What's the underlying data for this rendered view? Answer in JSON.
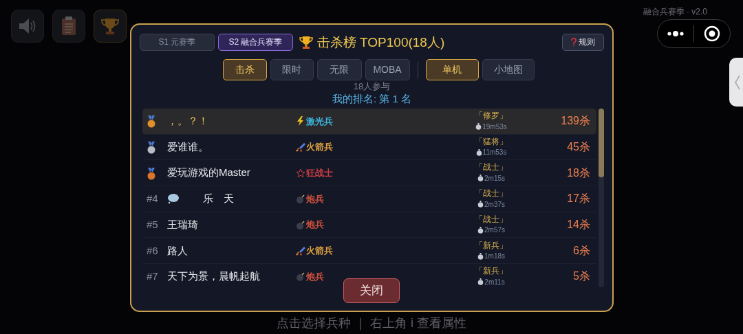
{
  "background": {
    "version": "融合兵赛季 · v2.0",
    "hint": "点击选择兵种 ｜ 右上角 i 查看属性"
  },
  "seasons": [
    {
      "label": "S1 元赛季",
      "selected": false
    },
    {
      "label": "S2 融合兵赛季",
      "selected": true
    }
  ],
  "title": "击杀榜 TOP100(18人)",
  "rules_button": "规则",
  "modes": [
    {
      "label": "击杀",
      "selected": true
    },
    {
      "label": "限时",
      "selected": false
    },
    {
      "label": "无限",
      "selected": false
    },
    {
      "label": "MOBA",
      "selected": false
    }
  ],
  "maps": [
    {
      "label": "单机",
      "selected": true
    },
    {
      "label": "小地图",
      "selected": false
    }
  ],
  "participants": "18人参与",
  "my_rank": "我的排名: 第 1 名",
  "rows": [
    {
      "rank": {
        "kind": "medal",
        "color": "#e0902a"
      },
      "name": "，。？！",
      "troop": {
        "kind": "laser",
        "label": "激光兵",
        "color": "#3cb4dc"
      },
      "rank_title": "「修罗」",
      "time": "19m53s",
      "kills": "139杀",
      "is_me": true
    },
    {
      "rank": {
        "kind": "medal",
        "color": "#b8bcc4"
      },
      "name": "爱谁谁。",
      "troop": {
        "kind": "rocket",
        "label": "火箭兵",
        "color": "#e0a040"
      },
      "rank_title": "「猛将」",
      "time": "11m53s",
      "kills": "45杀",
      "is_me": false
    },
    {
      "rank": {
        "kind": "medal",
        "color": "#d8742c"
      },
      "name": "爱玩游戏的Master",
      "troop": {
        "kind": "star",
        "label": "狂战士",
        "color": "#c83c46"
      },
      "rank_title": "「战士」",
      "time": "2m15s",
      "kills": "18杀",
      "is_me": false
    },
    {
      "rank": {
        "kind": "text",
        "label": "#4"
      },
      "name_icon": {
        "kind": "bubble"
      },
      "name": "乐　天",
      "troop": {
        "kind": "cannon",
        "label": "炮兵",
        "color": "#d2503c"
      },
      "rank_title": "「战士」",
      "time": "2m37s",
      "kills": "17杀",
      "is_me": false
    },
    {
      "rank": {
        "kind": "text",
        "label": "#5"
      },
      "name": "王瑞琦",
      "troop": {
        "kind": "cannon",
        "label": "炮兵",
        "color": "#d2503c"
      },
      "rank_title": "「战士」",
      "time": "2m57s",
      "kills": "14杀",
      "is_me": false
    },
    {
      "rank": {
        "kind": "text",
        "label": "#6"
      },
      "name": "路人",
      "troop": {
        "kind": "rocket",
        "label": "火箭兵",
        "color": "#e0a040"
      },
      "rank_title": "「新兵」",
      "time": "1m18s",
      "kills": "6杀",
      "is_me": false
    },
    {
      "rank": {
        "kind": "text",
        "label": "#7"
      },
      "name": "天下为景，晨帆起航",
      "troop": {
        "kind": "cannon",
        "label": "炮兵",
        "color": "#d2503c"
      },
      "rank_title": "「新兵」",
      "time": "2m11s",
      "kills": "5杀",
      "is_me": false
    }
  ],
  "close_button": "关闭"
}
